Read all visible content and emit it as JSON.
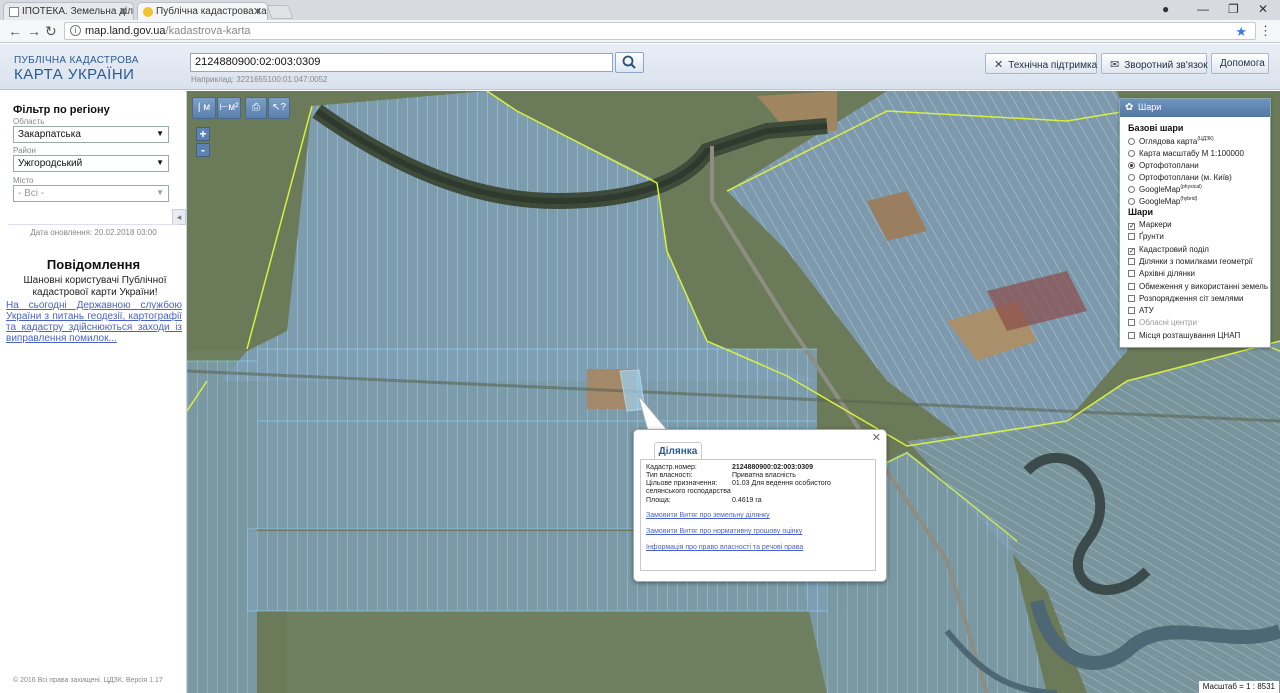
{
  "browser": {
    "tabs": [
      {
        "title": "ІПОТЕКА. Земельна ділян",
        "active": false
      },
      {
        "title": "Публічна кадастрова ка",
        "active": true
      }
    ],
    "url_host": "map.land.gov.ua",
    "url_path": "/kadastrova-karta",
    "info_icon": "info-icon"
  },
  "header": {
    "logo_line1": "ПУБЛІЧНА КАДАСТРОВА",
    "logo_line2": "КАРТА УКРАЇНИ",
    "search_value": "2124880900:02:003:0309",
    "search_hint": "Наприклад: 3221655100:01:047:0052",
    "buttons": {
      "support": "Технічна підтримка",
      "feedback": "Зворотний зв'язок",
      "help": "Допомога"
    }
  },
  "filter": {
    "title": "Фільтр по регіону",
    "oblast_label": "Область",
    "oblast_value": "Закарпатська",
    "rayon_label": "Район",
    "rayon_value": "Ужгородський",
    "city_label": "Місто",
    "city_value": "- Всі -",
    "update_date": "Дата оновлення: 20.02.2018 03:00"
  },
  "news": {
    "title": "Повідомлення",
    "text": "Шановні користувачі Публічної кадастрової карти України!",
    "link": "На сьогодні Державною службою України з питань геодезії, картографії та кадастру здійснюються заходи із виправлення помилок..."
  },
  "footer": "© 2016 Всі права захищені. ЦДЗК. Версія 1.17",
  "toolbar": {
    "ruler_label": "| м",
    "area_label": "⊢м²",
    "zoom_in": "+",
    "zoom_out": "-"
  },
  "popup": {
    "tab": "Ділянка",
    "rows": [
      {
        "key": "Кадастр.номер:",
        "value": "2124880900:02:003:0309"
      },
      {
        "key": "Тип власності:",
        "value": "Приватна власність"
      },
      {
        "key": "Цільове призначення:",
        "value": "01.03 Для ведення особистого селянського господарства"
      },
      {
        "key": "Площа:",
        "value": "0.4619 га"
      }
    ],
    "links": [
      "Замовити Витяг про земельну ділянку",
      "Замовити Витяг про нормативну грошову оцінку",
      "Інформація про право власності та речові права"
    ]
  },
  "layers": {
    "title": "Шари",
    "base_title": "Базові шари",
    "base": [
      {
        "label": "Оглядова карта",
        "sup": "(ЦДЗК)",
        "selected": false
      },
      {
        "label": "Карта масштабу М 1:100000",
        "sup": "",
        "selected": false
      },
      {
        "label": "Ортофотоплани",
        "sup": "",
        "selected": true
      },
      {
        "label": "Ортофотоплани (м. Київ)",
        "sup": "",
        "selected": false
      },
      {
        "label": "GoogleMap",
        "sup": "(physical)",
        "selected": false
      },
      {
        "label": "GoogleMap",
        "sup": "(hybrid)",
        "selected": false
      }
    ],
    "overlay_title": "Шари",
    "overlays": [
      {
        "label": "Маркери",
        "checked": true,
        "disabled": false
      },
      {
        "label": "Ґрунти",
        "checked": false,
        "disabled": false
      },
      {
        "label": "Кадастровий поділ",
        "checked": true,
        "disabled": false
      },
      {
        "label": "Ділянки з помилками геометрії",
        "checked": false,
        "disabled": false
      },
      {
        "label": "Архівні ділянки",
        "checked": false,
        "disabled": false
      },
      {
        "label": "Обмеження у використанні земель",
        "checked": false,
        "disabled": false
      },
      {
        "label": "Розпорядження сіт землями",
        "checked": false,
        "disabled": false
      },
      {
        "label": "АТУ",
        "checked": false,
        "disabled": false
      },
      {
        "label": "Обласні центри",
        "checked": false,
        "disabled": true
      },
      {
        "label": "Місця розташування ЦНАП",
        "checked": false,
        "disabled": false
      }
    ]
  },
  "scale": "Масштаб = 1 : 8531",
  "colors": {
    "brand_blue": "#2b5a93",
    "link": "#4a62c7",
    "parcel_line": "#8fd3ff",
    "boundary_line": "#d8f040"
  }
}
